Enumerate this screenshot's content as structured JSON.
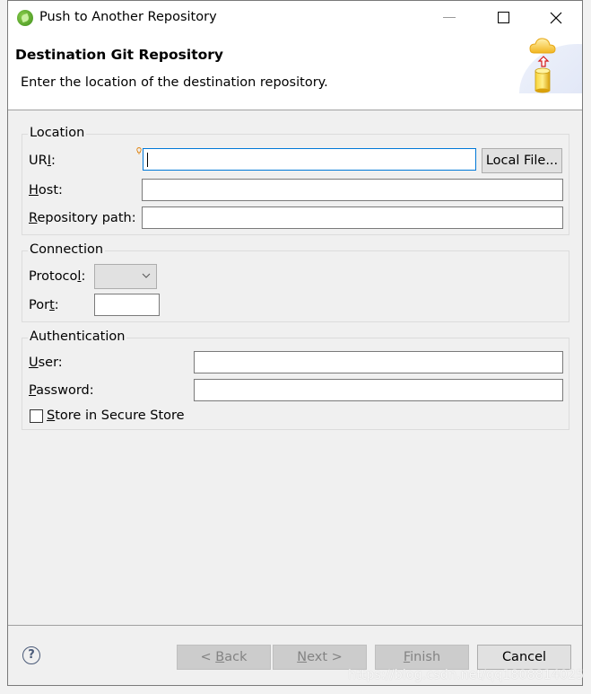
{
  "window": {
    "title": "Push to Another Repository"
  },
  "header": {
    "title": "Destination Git Repository",
    "description": "Enter the location of the destination repository."
  },
  "location": {
    "group_label": "Location",
    "uri_label_pre": "UR",
    "uri_label_mnemonic": "I",
    "uri_label_post": ":",
    "uri_value": "",
    "local_file_button": "Local File...",
    "host_label_mnemonic": "H",
    "host_label_post": "ost:",
    "host_value": "",
    "repo_path_label_mnemonic": "R",
    "repo_path_label_post": "epository path:",
    "repo_path_value": ""
  },
  "connection": {
    "group_label": "Connection",
    "protocol_label_pre": "Protoco",
    "protocol_label_mnemonic": "l",
    "protocol_label_post": ":",
    "protocol_value": "",
    "port_label_pre": "Por",
    "port_label_mnemonic": "t",
    "port_label_post": ":",
    "port_value": ""
  },
  "authentication": {
    "group_label": "Authentication",
    "user_label_mnemonic": "U",
    "user_label_post": "ser:",
    "user_value": "",
    "password_label_mnemonic": "P",
    "password_label_post": "assword:",
    "password_value": "",
    "store_label_mnemonic": "S",
    "store_label_post": "tore in Secure Store",
    "store_checked": false
  },
  "footer": {
    "help_glyph": "?",
    "back_pre": "< ",
    "back_mnemonic": "B",
    "back_post": "ack",
    "next_mnemonic": "N",
    "next_post": "ext >",
    "finish_mnemonic": "F",
    "finish_post": "inish",
    "cancel": "Cancel"
  },
  "watermark": "https://blog.csdn.net/qq1808814025"
}
